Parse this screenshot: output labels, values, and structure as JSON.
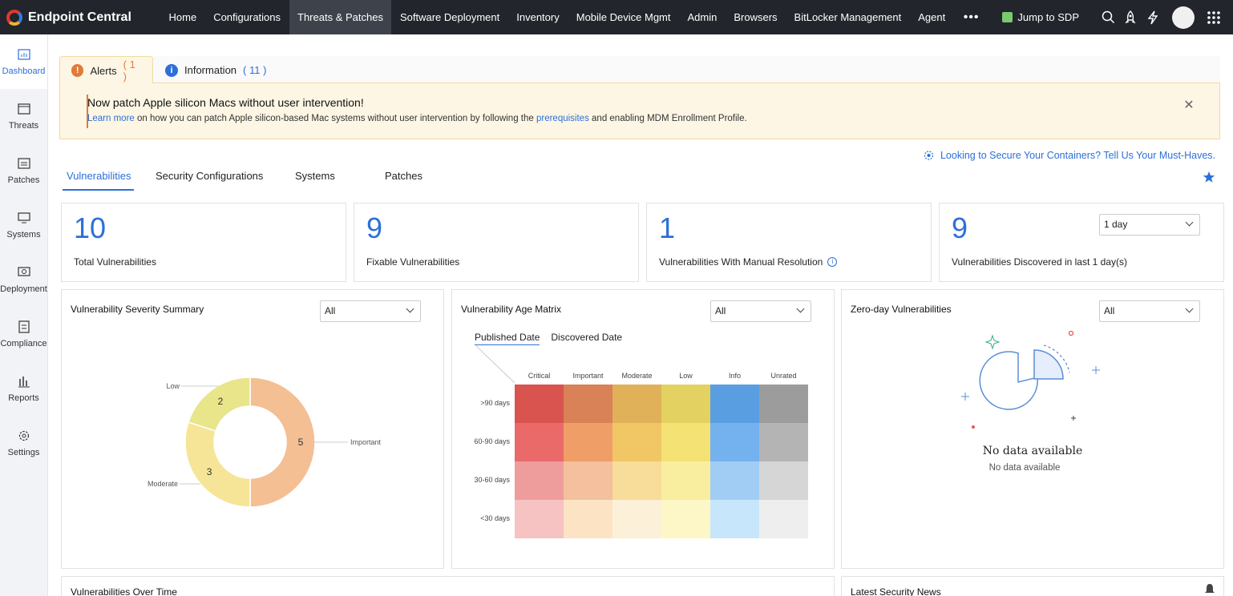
{
  "app": {
    "brand": "Endpoint Central"
  },
  "nav": {
    "items": [
      "Home",
      "Configurations",
      "Threats & Patches",
      "Software Deployment",
      "Inventory",
      "Mobile Device Mgmt",
      "Admin",
      "Browsers",
      "BitLocker Management",
      "Agent"
    ],
    "active": "Threats & Patches",
    "more": "•••",
    "jump_label": "Jump to SDP"
  },
  "sidebar": {
    "items": [
      {
        "label": "Dashboard",
        "icon": "dashboard-icon"
      },
      {
        "label": "Threats",
        "icon": "threats-icon"
      },
      {
        "label": "Patches",
        "icon": "patches-icon"
      },
      {
        "label": "Systems",
        "icon": "systems-icon"
      },
      {
        "label": "Deployment",
        "icon": "deployment-icon"
      },
      {
        "label": "Compliance",
        "icon": "compliance-icon"
      },
      {
        "label": "Reports",
        "icon": "reports-icon"
      },
      {
        "label": "Settings",
        "icon": "settings-icon"
      }
    ],
    "active": "Dashboard"
  },
  "alerts": {
    "tabs": [
      {
        "label": "Alerts",
        "count": "( 1 )",
        "icon": "alert-icon",
        "color": "#e07b39"
      },
      {
        "label": "Information",
        "count": "( 11 )",
        "icon": "info-icon",
        "color": "#2c6fd9"
      }
    ],
    "title": "Now patch Apple silicon Macs without user intervention!",
    "text_link1": "Learn more",
    "text_mid": " on how you can patch Apple silicon-based Mac systems without user intervention by following the ",
    "text_link2": "prerequisites",
    "text_end": " and enabling MDM Enrollment Profile."
  },
  "promo": "Looking to Secure Your Containers? Tell Us Your Must-Haves.",
  "subtabs": [
    "Vulnerabilities",
    "Security Configurations",
    "Systems",
    "Patches"
  ],
  "kpis": [
    {
      "value": "10",
      "label": "Total Vulnerabilities"
    },
    {
      "value": "9",
      "label": "Fixable Vulnerabilities"
    },
    {
      "value": "1",
      "label": "Vulnerabilities With Manual Resolution"
    },
    {
      "value": "9",
      "label": "Vulnerabilities Discovered in last 1 day(s)",
      "select": "1 day"
    }
  ],
  "severity": {
    "title": "Vulnerability Severity Summary",
    "filter": "All"
  },
  "chart_data": {
    "type": "pie",
    "categories": [
      "Important",
      "Moderate",
      "Low"
    ],
    "values": [
      5,
      3,
      2
    ],
    "colors": [
      "#f3bf93",
      "#f6e597",
      "#e8e58a"
    ]
  },
  "age_matrix": {
    "title": "Vulnerability Age Matrix",
    "filter": "All",
    "tabs": [
      "Published Date",
      "Discovered Date"
    ],
    "columns": [
      "Critical",
      "Important",
      "Moderate",
      "Low",
      "Info",
      "Unrated"
    ],
    "rows": [
      ">90 days",
      "60-90 days",
      "30-60 days",
      "<30 days"
    ],
    "colors": [
      [
        "#d9534f",
        "#d98157",
        "#e0b158",
        "#e3d261",
        "#5a9ee2",
        "#9c9c9c"
      ],
      [
        "#ea6a6a",
        "#ef9e67",
        "#f1c765",
        "#f5e274",
        "#74b1ef",
        "#b4b4b4"
      ],
      [
        "#ef9c9c",
        "#f4c09d",
        "#f7dc9a",
        "#f9ee9f",
        "#a1cdf5",
        "#d6d6d6"
      ],
      [
        "#f6c2c2",
        "#fbe3c4",
        "#fdf0d9",
        "#fdf7c8",
        "#c7e6fb",
        "#eeeeee"
      ]
    ]
  },
  "zero_day": {
    "title": "Zero-day Vulnerabilities",
    "filter": "All",
    "nodata_title": "No data available",
    "nodata_sub": "No data available"
  },
  "bottom": {
    "left_title": "Vulnerabilities Over Time",
    "right_title": "Latest Security News"
  }
}
